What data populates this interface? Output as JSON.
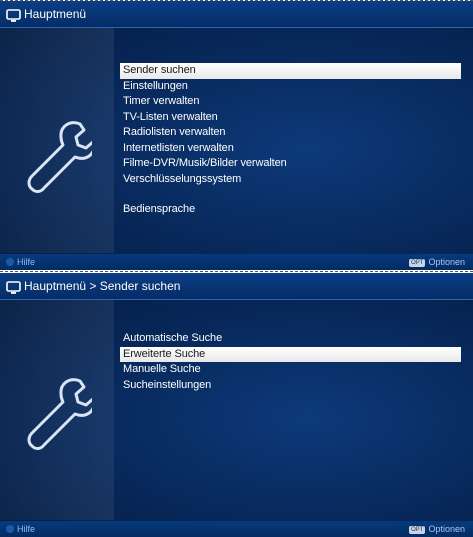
{
  "screen1": {
    "title": "Hauptmenü",
    "menu": [
      {
        "label": "Sender suchen",
        "selected": true
      },
      {
        "label": "Einstellungen",
        "selected": false
      },
      {
        "label": "Timer verwalten",
        "selected": false
      },
      {
        "label": "TV-Listen verwalten",
        "selected": false
      },
      {
        "label": "Radiolisten verwalten",
        "selected": false
      },
      {
        "label": "Internetlisten verwalten",
        "selected": false
      },
      {
        "label": "Filme-DVR/Musik/Bilder verwalten",
        "selected": false
      },
      {
        "label": "Verschlüsselungssystem",
        "selected": false
      },
      {
        "label": "Bediensprache",
        "selected": false
      }
    ],
    "footer": {
      "help": "Hilfe",
      "options": "Optionen",
      "options_key": "OPT"
    }
  },
  "screen2": {
    "title": "Hauptmenü > Sender suchen",
    "menu": [
      {
        "label": "Automatische Suche",
        "selected": false
      },
      {
        "label": "Erweiterte Suche",
        "selected": true
      },
      {
        "label": "Manuelle Suche",
        "selected": false
      },
      {
        "label": "Sucheinstellungen",
        "selected": false
      }
    ],
    "footer": {
      "help": "Hilfe",
      "options": "Optionen",
      "options_key": "OPT"
    }
  },
  "icons": {
    "title": "tv-icon",
    "menu": "wrench-icon",
    "help": "blue-button-icon"
  },
  "colors": {
    "background": "#082a5e",
    "highlight": "#ffffff",
    "text": "#ffffff",
    "footer_text": "#8fb8ff"
  }
}
